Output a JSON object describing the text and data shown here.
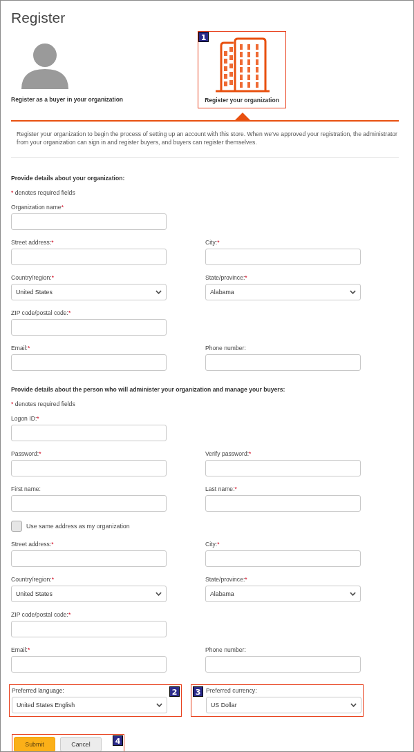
{
  "title": "Register",
  "options": [
    {
      "label": "Register as a buyer in your organization",
      "kind": "person",
      "selected": false
    },
    {
      "label": "Register your organization",
      "kind": "building",
      "selected": true,
      "callout": "1"
    }
  ],
  "description": "Register your organization to begin the process of setting up an account with this store. When we've approved your registration, the administrator from your organization can sign in and register buyers, and buyers can register themselves.",
  "sections": [
    {
      "heading": "Provide details about your organization:",
      "required_mark": "*",
      "required_note": "denotes required fields",
      "rows": [
        [
          {
            "kind": "text",
            "label": "Organization name",
            "required_mark": "*"
          }
        ],
        [
          {
            "kind": "text",
            "label": "Street address:",
            "required_mark": "*"
          },
          {
            "kind": "text",
            "label": "City:",
            "required_mark": "*"
          }
        ],
        [
          {
            "kind": "select",
            "label": "Country/region:",
            "required_mark": "*",
            "value": "United States"
          },
          {
            "kind": "select",
            "label": "State/province:",
            "required_mark": "*",
            "value": "Alabama"
          }
        ],
        [
          {
            "kind": "text",
            "label": "ZIP code/postal code:",
            "required_mark": "*"
          }
        ],
        [
          {
            "kind": "text",
            "label": "Email:",
            "required_mark": "*"
          },
          {
            "kind": "text",
            "label": "Phone number:"
          }
        ]
      ]
    },
    {
      "heading": "Provide details about the person who will administer your organization and manage your buyers:",
      "required_mark": "*",
      "required_note": "denotes required fields",
      "rows": [
        [
          {
            "kind": "text",
            "label": "Logon ID:",
            "required_mark": "*"
          }
        ],
        [
          {
            "kind": "text",
            "label": "Password:",
            "required_mark": "*"
          },
          {
            "kind": "text",
            "label": "Verify password:",
            "required_mark": "*"
          }
        ],
        [
          {
            "kind": "text",
            "label": "First name:"
          },
          {
            "kind": "text",
            "label": "Last name:",
            "required_mark": "*"
          }
        ],
        [
          {
            "kind": "checkbox",
            "label": "Use same address as my organization",
            "checked": false
          }
        ],
        [
          {
            "kind": "text",
            "label": "Street address:",
            "required_mark": "*"
          },
          {
            "kind": "text",
            "label": "City:",
            "required_mark": "*"
          }
        ],
        [
          {
            "kind": "select",
            "label": "Country/region:",
            "required_mark": "*",
            "value": "United States"
          },
          {
            "kind": "select",
            "label": "State/province:",
            "required_mark": "*",
            "value": "Alabama"
          }
        ],
        [
          {
            "kind": "text",
            "label": "ZIP code/postal code:",
            "required_mark": "*"
          }
        ],
        [
          {
            "kind": "text",
            "label": "Email:",
            "required_mark": "*"
          },
          {
            "kind": "text",
            "label": "Phone number:"
          }
        ],
        [
          {
            "kind": "select",
            "label": "Preferred language:",
            "value": "United States English",
            "callout": "2"
          },
          {
            "kind": "select",
            "label": "Preferred currency:",
            "value": "US Dollar",
            "callout": "3"
          }
        ]
      ]
    }
  ],
  "buttons": [
    {
      "label": "Submit",
      "kind": "primary"
    },
    {
      "label": "Cancel",
      "kind": "secondary"
    }
  ],
  "buttons_callout": "4"
}
